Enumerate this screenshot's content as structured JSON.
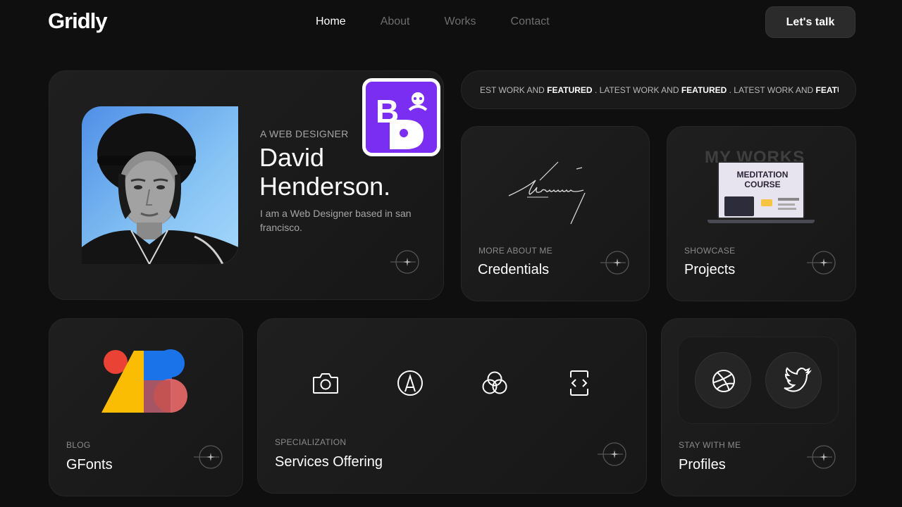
{
  "header": {
    "logo": "Gridly",
    "nav": [
      "Home",
      "About",
      "Works",
      "Contact"
    ],
    "cta": "Let's talk"
  },
  "hero": {
    "role": "A WEB DESIGNER",
    "name": "David Henderson.",
    "description": "I am a Web Designer based in san francisco."
  },
  "marquee": {
    "segments": [
      {
        "plain": "EST WORK AND ",
        "bold": "FEATURED"
      },
      {
        "plain": " . LATEST WORK AND ",
        "bold": "FEATURED"
      },
      {
        "plain": " . LATEST WORK AND ",
        "bold": "FEATU"
      }
    ]
  },
  "credentials": {
    "label": "MORE ABOUT ME",
    "title": "Credentials"
  },
  "projects": {
    "label": "SHOWCASE",
    "title": "Projects",
    "bg_text": "MY WORKS",
    "screen_title": "MEDITATION COURSE"
  },
  "blog": {
    "label": "BLOG",
    "title": "GFonts"
  },
  "services": {
    "label": "SPECIALIZATION",
    "title": "Services Offering",
    "icons": [
      "camera-icon",
      "pen-tool-icon",
      "color-circles-icon",
      "code-icon"
    ]
  },
  "profiles": {
    "label": "STAY WITH ME",
    "title": "Profiles",
    "icons": [
      "dribbble-icon",
      "twitter-icon"
    ]
  },
  "colors": {
    "background": "#0f0f0f",
    "card": "#1c1c1c",
    "brand_purple": "#7a2ef2"
  }
}
